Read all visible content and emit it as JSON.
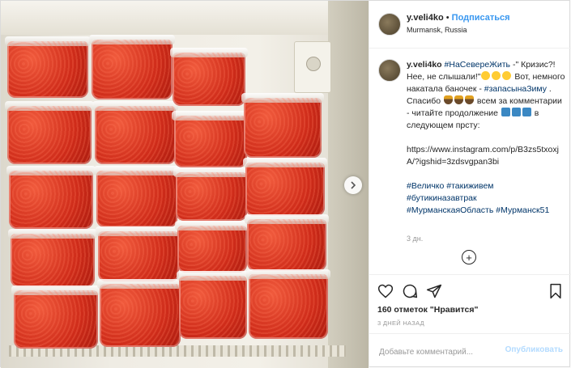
{
  "post": {
    "username": "y.veli4ko",
    "separator": "•",
    "follow_label": "Подписаться",
    "location": "Murmansk, Russia"
  },
  "caption": {
    "username": "y.veli4ko",
    "tag1": "#НаСевереЖить",
    "text1": " -\" Кризис?! Нее, не слышали!\"",
    "text2": " Вот, немного накатала баночек - ",
    "tag2": "#запасынаЗиму",
    "text3": " .",
    "text4": "Спасибо",
    "text5": "всем за комментарии - читайте продолжение",
    "text6": " в следующем прсту:",
    "link": "https://www.instagram.com/p/B3zs5txoxjA/?igshid=3zdsvgpan3bi",
    "tag3": "#Величко",
    "tag4": "#такиживем",
    "tag5": "#бутикиназавтрак",
    "tag6": "#МурманскаяОбласть",
    "tag7": "#Мурманск51",
    "time": "3 дн."
  },
  "actions": {
    "likes": "160 отметок \"Нравится\"",
    "ago": "3 ДНЕЙ НАЗАД"
  },
  "comment": {
    "placeholder": "Добавьте комментарий...",
    "publish_label": "Опубликовать"
  },
  "icons": {
    "like": "heart-icon",
    "comment": "comment-icon",
    "share": "share-icon",
    "save": "bookmark-icon",
    "next": "chevron-right-icon",
    "more": "plus-circle-icon"
  },
  "colors": {
    "link": "#3897f0",
    "hashtag": "#003569",
    "caviar": "#cf2c1a"
  }
}
